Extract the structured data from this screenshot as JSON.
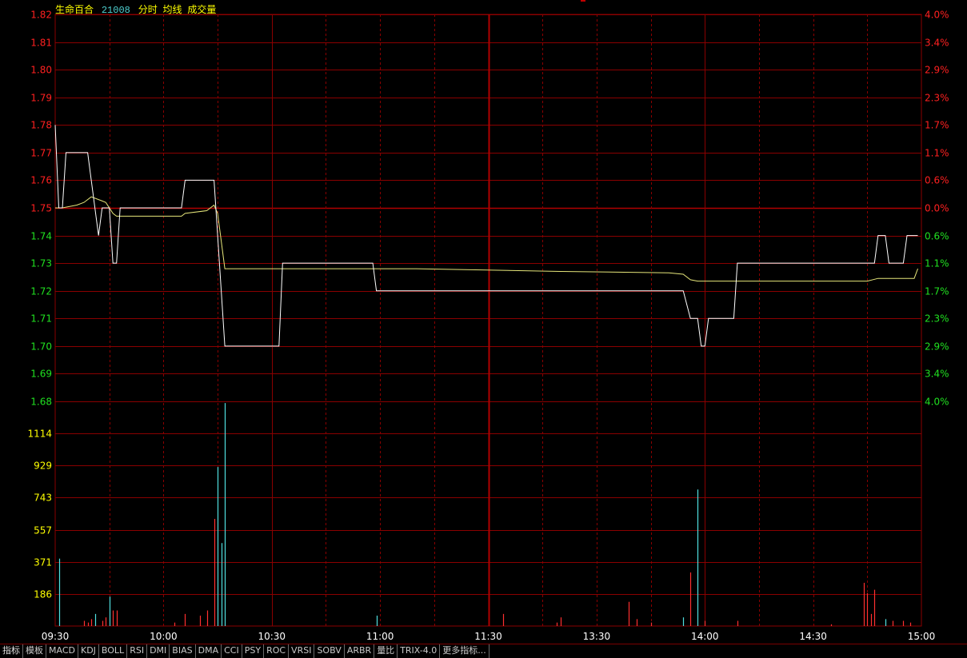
{
  "header": {
    "stock_name": "生命百合",
    "code": "21008",
    "mode": "分时",
    "avg_label": "均线",
    "vol_label": "成交量"
  },
  "colors": {
    "grid": "#8a0000",
    "grid_center": "#b00000",
    "up": "#ff2020",
    "down": "#20e020",
    "volume_label": "#ffff00",
    "price_line": "#ffffff",
    "avg_line": "#e6e67a",
    "vol_up": "#ff3030",
    "vol_down": "#50e0e0"
  },
  "chart_data": {
    "type": "line",
    "prev_close": 1.75,
    "price_ylim": [
      1.68,
      1.82
    ],
    "price_ticks": [
      "1.82",
      "1.81",
      "1.80",
      "1.79",
      "1.78",
      "1.77",
      "1.76",
      "1.75",
      "1.74",
      "1.73",
      "1.72",
      "1.71",
      "1.70",
      "1.69",
      "1.68"
    ],
    "pct_ticks": [
      "4.0%",
      "3.4%",
      "2.9%",
      "2.3%",
      "1.7%",
      "1.1%",
      "0.6%",
      "0.0%",
      "0.6%",
      "1.1%",
      "1.7%",
      "2.3%",
      "2.9%",
      "3.4%",
      "4.0%"
    ],
    "volume_ylim": [
      0,
      1300
    ],
    "volume_ticks": [
      "1114",
      "929",
      "743",
      "557",
      "371",
      "186"
    ],
    "volume_tick_values": [
      1114,
      929,
      743,
      557,
      371,
      186
    ],
    "x_ticks": [
      "09:30",
      "10:00",
      "10:30",
      "11:00",
      "11:30",
      "13:30",
      "14:00",
      "14:30",
      "15:00"
    ],
    "x_tick_minutes": [
      0,
      30,
      60,
      90,
      120,
      150,
      180,
      210,
      240
    ],
    "price_series": {
      "name": "分时",
      "points": [
        [
          0,
          1.78
        ],
        [
          1,
          1.75
        ],
        [
          2,
          1.75
        ],
        [
          3,
          1.77
        ],
        [
          9,
          1.77
        ],
        [
          10,
          1.76
        ],
        [
          12,
          1.74
        ],
        [
          13,
          1.75
        ],
        [
          15,
          1.75
        ],
        [
          16,
          1.73
        ],
        [
          17,
          1.73
        ],
        [
          18,
          1.75
        ],
        [
          35,
          1.75
        ],
        [
          36,
          1.76
        ],
        [
          44,
          1.76
        ],
        [
          45,
          1.74
        ],
        [
          46,
          1.72
        ],
        [
          47,
          1.7
        ],
        [
          62,
          1.7
        ],
        [
          63,
          1.73
        ],
        [
          88,
          1.73
        ],
        [
          89,
          1.72
        ],
        [
          174,
          1.72
        ],
        [
          176,
          1.71
        ],
        [
          178,
          1.71
        ],
        [
          179,
          1.7
        ],
        [
          180,
          1.7
        ],
        [
          181,
          1.71
        ],
        [
          188,
          1.71
        ],
        [
          189,
          1.73
        ],
        [
          227,
          1.73
        ],
        [
          228,
          1.74
        ],
        [
          230,
          1.74
        ],
        [
          231,
          1.73
        ],
        [
          235,
          1.73
        ],
        [
          236,
          1.74
        ],
        [
          239,
          1.74
        ]
      ]
    },
    "avg_series": {
      "name": "均线",
      "points": [
        [
          0,
          1.75
        ],
        [
          2,
          1.75
        ],
        [
          6,
          1.751
        ],
        [
          8,
          1.752
        ],
        [
          10,
          1.754
        ],
        [
          12,
          1.753
        ],
        [
          14,
          1.752
        ],
        [
          16,
          1.748
        ],
        [
          17,
          1.747
        ],
        [
          35,
          1.747
        ],
        [
          36,
          1.748
        ],
        [
          42,
          1.749
        ],
        [
          44,
          1.751
        ],
        [
          45,
          1.748
        ],
        [
          46,
          1.738
        ],
        [
          47,
          1.728
        ],
        [
          62,
          1.728
        ],
        [
          100,
          1.728
        ],
        [
          140,
          1.727
        ],
        [
          170,
          1.7265
        ],
        [
          174,
          1.726
        ],
        [
          176,
          1.724
        ],
        [
          178,
          1.7235
        ],
        [
          210,
          1.7235
        ],
        [
          225,
          1.7235
        ],
        [
          228,
          1.7245
        ],
        [
          238,
          1.7245
        ],
        [
          239,
          1.728
        ]
      ]
    },
    "volume_bars": [
      {
        "t": 1,
        "v": 390,
        "dir": "down"
      },
      {
        "t": 8,
        "v": 30,
        "dir": "up"
      },
      {
        "t": 9,
        "v": 20,
        "dir": "up"
      },
      {
        "t": 10,
        "v": 40,
        "dir": "up"
      },
      {
        "t": 11,
        "v": 70,
        "dir": "down"
      },
      {
        "t": 13,
        "v": 30,
        "dir": "up"
      },
      {
        "t": 14,
        "v": 50,
        "dir": "up"
      },
      {
        "t": 15,
        "v": 170,
        "dir": "down"
      },
      {
        "t": 16,
        "v": 90,
        "dir": "up"
      },
      {
        "t": 17,
        "v": 90,
        "dir": "up"
      },
      {
        "t": 33,
        "v": 20,
        "dir": "up"
      },
      {
        "t": 36,
        "v": 70,
        "dir": "up"
      },
      {
        "t": 40,
        "v": 60,
        "dir": "up"
      },
      {
        "t": 42,
        "v": 90,
        "dir": "up"
      },
      {
        "t": 44,
        "v": 620,
        "dir": "up"
      },
      {
        "t": 45,
        "v": 920,
        "dir": "down"
      },
      {
        "t": 46,
        "v": 480,
        "dir": "down"
      },
      {
        "t": 47,
        "v": 1290,
        "dir": "down"
      },
      {
        "t": 89,
        "v": 60,
        "dir": "down"
      },
      {
        "t": 124,
        "v": 70,
        "dir": "up"
      },
      {
        "t": 139,
        "v": 20,
        "dir": "up"
      },
      {
        "t": 140,
        "v": 50,
        "dir": "up"
      },
      {
        "t": 159,
        "v": 140,
        "dir": "up"
      },
      {
        "t": 161,
        "v": 40,
        "dir": "up"
      },
      {
        "t": 165,
        "v": 20,
        "dir": "up"
      },
      {
        "t": 174,
        "v": 50,
        "dir": "down"
      },
      {
        "t": 176,
        "v": 310,
        "dir": "up"
      },
      {
        "t": 178,
        "v": 790,
        "dir": "down"
      },
      {
        "t": 180,
        "v": 30,
        "dir": "up"
      },
      {
        "t": 189,
        "v": 30,
        "dir": "up"
      },
      {
        "t": 215,
        "v": 10,
        "dir": "up"
      },
      {
        "t": 224,
        "v": 250,
        "dir": "up"
      },
      {
        "t": 225,
        "v": 190,
        "dir": "up"
      },
      {
        "t": 226,
        "v": 70,
        "dir": "up"
      },
      {
        "t": 227,
        "v": 210,
        "dir": "up"
      },
      {
        "t": 230,
        "v": 40,
        "dir": "down"
      },
      {
        "t": 232,
        "v": 30,
        "dir": "up"
      },
      {
        "t": 235,
        "v": 30,
        "dir": "up"
      },
      {
        "t": 237,
        "v": 20,
        "dir": "up"
      }
    ]
  },
  "tabs": [
    "指标",
    "模板",
    "MACD",
    "KDJ",
    "BOLL",
    "RSI",
    "DMI",
    "BIAS",
    "DMA",
    "CCI",
    "PSY",
    "ROC",
    "VRSI",
    "SOBV",
    "ARBR",
    "量比",
    "TRIX-4.0",
    "更多指标..."
  ]
}
